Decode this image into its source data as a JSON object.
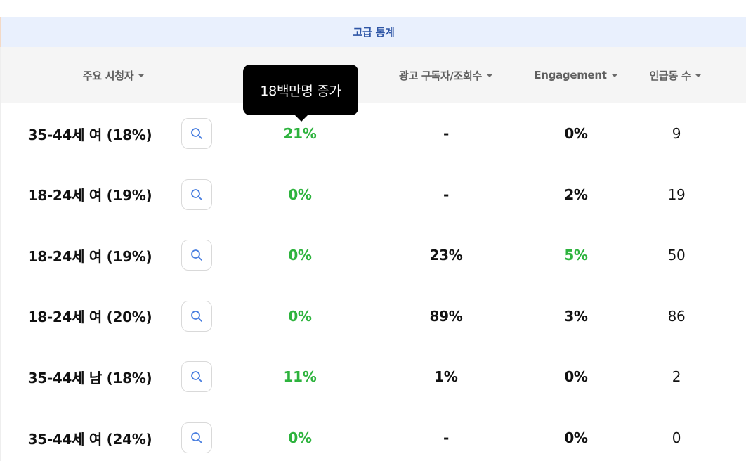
{
  "banner": {
    "title": "고급 통계"
  },
  "columns": [
    {
      "label": "주요 시청자"
    },
    {
      "label": "광고 구독자/조회수"
    },
    {
      "label": "Engagement"
    },
    {
      "label": "인급동 수"
    }
  ],
  "tooltip": {
    "text": "18백만명 증가"
  },
  "colors": {
    "green": "#2db33d",
    "dark": "#111111",
    "search_icon": "#4a7fe0"
  },
  "rows": [
    {
      "audience": "35-44세 여 (18%)",
      "growth": "21%",
      "growth_color": "#2db33d",
      "ad_ratio": "-",
      "engagement": "0%",
      "engagement_color": "#111111",
      "trending": "9"
    },
    {
      "audience": "18-24세 여 (19%)",
      "growth": "0%",
      "growth_color": "#2db33d",
      "ad_ratio": "-",
      "engagement": "2%",
      "engagement_color": "#111111",
      "trending": "19"
    },
    {
      "audience": "18-24세 여 (19%)",
      "growth": "0%",
      "growth_color": "#2db33d",
      "ad_ratio": "23%",
      "engagement": "5%",
      "engagement_color": "#2db33d",
      "trending": "50"
    },
    {
      "audience": "18-24세 여 (20%)",
      "growth": "0%",
      "growth_color": "#2db33d",
      "ad_ratio": "89%",
      "engagement": "3%",
      "engagement_color": "#111111",
      "trending": "86"
    },
    {
      "audience": "35-44세 남 (18%)",
      "growth": "11%",
      "growth_color": "#2db33d",
      "ad_ratio": "1%",
      "engagement": "0%",
      "engagement_color": "#111111",
      "trending": "2"
    },
    {
      "audience": "35-44세 여 (24%)",
      "growth": "0%",
      "growth_color": "#2db33d",
      "ad_ratio": "-",
      "engagement": "0%",
      "engagement_color": "#111111",
      "trending": "0"
    }
  ]
}
